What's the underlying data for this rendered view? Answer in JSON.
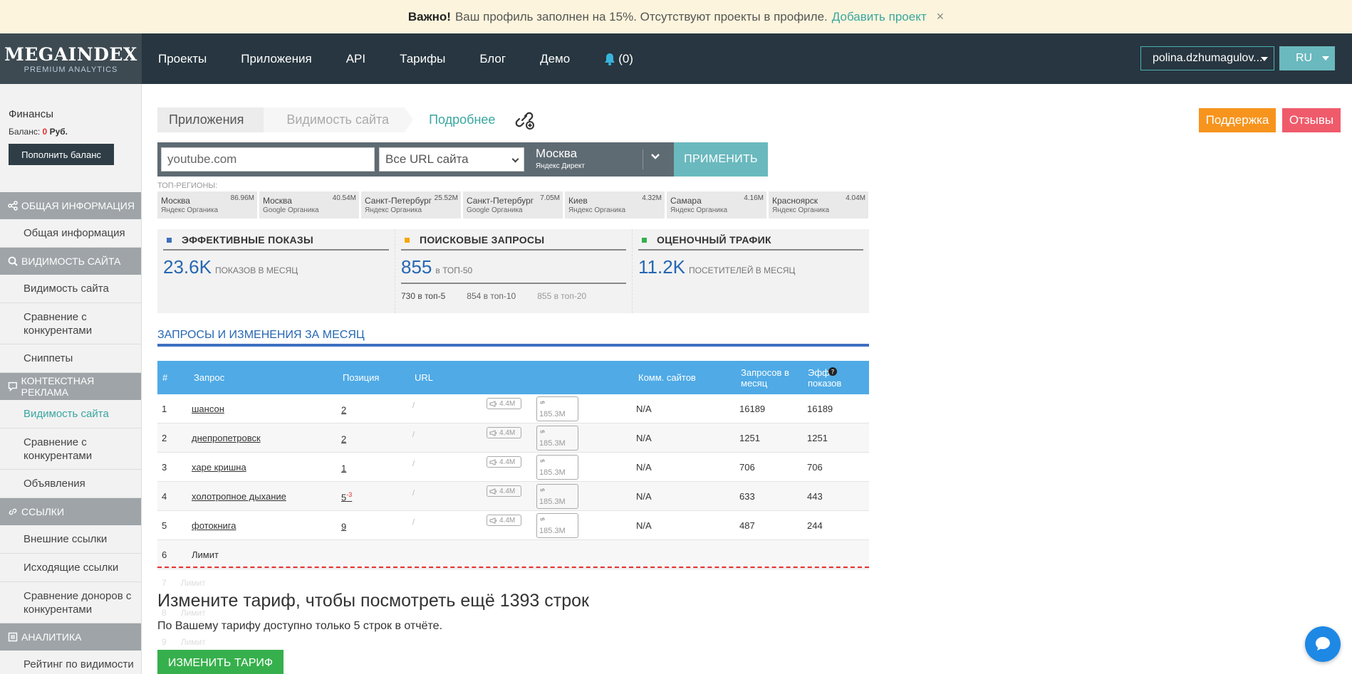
{
  "notice": {
    "strong": "Важно!",
    "text": "Ваш профиль заполнен на 15%. Отсутствуют проекты в профиле.",
    "link": "Добавить проект",
    "close": "×"
  },
  "header": {
    "logo_main": "MEGAINDEX",
    "logo_sub": "PREMIUM ANALYTICS",
    "nav": [
      "Проекты",
      "Приложения",
      "API",
      "Тарифы",
      "Блог",
      "Демо"
    ],
    "notifications": "(0)",
    "user": "polina.dzhumagulov...",
    "lang": "RU"
  },
  "sidebar": {
    "finance_title": "Финансы",
    "balance_label": "Баланс:",
    "balance_value": "0",
    "balance_currency": "Руб.",
    "topup": "Пополнить баланс",
    "sections": [
      {
        "title": "ОБЩАЯ ИНФОРМАЦИЯ",
        "items": [
          "Общая информация"
        ]
      },
      {
        "title": "ВИДИМОСТЬ САЙТА",
        "items": [
          "Видимость сайта",
          "Сравнение с конкурентами",
          "Сниппеты"
        ]
      },
      {
        "title": "КОНТЕКСТНАЯ РЕКЛАМА",
        "items": [
          "Видимость сайта",
          "Сравнение с конкурентами",
          "Объявления"
        ]
      },
      {
        "title": "ССЫЛКИ",
        "items": [
          "Внешние ссылки",
          "Исходящие ссылки",
          "Сравнение доноров с конкурентами"
        ]
      },
      {
        "title": "АНАЛИТИКА",
        "items": [
          "Рейтинг по видимости"
        ]
      }
    ]
  },
  "breadcrumb": [
    "Приложения",
    "Видимость сайта",
    "Подробнее"
  ],
  "support": "Поддержка",
  "reviews": "Отзывы",
  "filters": {
    "domain": "youtube.com",
    "url_select": "Все URL сайта",
    "region": "Москва",
    "region_source": "Яндекс Директ",
    "apply": "ПРИМЕНИТЬ"
  },
  "top_regions_label": "ТОП-РЕГИОНЫ:",
  "regions": [
    {
      "name": "Москва",
      "engine": "Яндекс Органика",
      "value": "86.96M"
    },
    {
      "name": "Москва",
      "engine": "Google Органика",
      "value": "40.54M"
    },
    {
      "name": "Санкт-Петербург",
      "engine": "Яндекс Органика",
      "value": "25.52M"
    },
    {
      "name": "Санкт-Петербург",
      "engine": "Google Органика",
      "value": "7.05M"
    },
    {
      "name": "Киев",
      "engine": "Яндекс Органика",
      "value": "4.32M"
    },
    {
      "name": "Самара",
      "engine": "Яндекс Органика",
      "value": "4.16M"
    },
    {
      "name": "Красноярск",
      "engine": "Яндекс Органика",
      "value": "4.04M"
    }
  ],
  "metrics": [
    {
      "title": "ЭФФЕКТИВНЫЕ ПОКАЗЫ",
      "value": "23.6K",
      "unit": "показов в месяц",
      "color": "#3e6fbf"
    },
    {
      "title": "ПОИСКОВЫЕ ЗАПРОСЫ",
      "value": "855",
      "unit": "в ТОП-50",
      "color": "#f7a600",
      "breakdown": [
        "730 в топ-5",
        "854 в топ-10",
        "855 в топ-20"
      ]
    },
    {
      "title": "ОЦЕНОЧНЫЙ ТРАФИК",
      "value": "11.2K",
      "unit": "посетителей в месяц",
      "color": "#36b04c"
    }
  ],
  "table": {
    "title": "ЗАПРОСЫ И ИЗМЕНЕНИЯ ЗА МЕСЯЦ",
    "headers": [
      "#",
      "Запрос",
      "Позиция",
      "URL",
      "Комм. сайтов",
      "Запросов в месяц",
      "Эфф показов"
    ],
    "rows": [
      {
        "n": "1",
        "q": "шансон",
        "pos": "2",
        "delta": "",
        "ads": "4.4M",
        "links": "185.3M",
        "comm": "N/A",
        "req": "16189",
        "eff": "16189"
      },
      {
        "n": "2",
        "q": "днепропетровск",
        "pos": "2",
        "delta": "",
        "ads": "4.4M",
        "links": "185.3M",
        "comm": "N/A",
        "req": "1251",
        "eff": "1251"
      },
      {
        "n": "3",
        "q": "харе кришна",
        "pos": "1",
        "delta": "",
        "ads": "4.4M",
        "links": "185.3M",
        "comm": "N/A",
        "req": "706",
        "eff": "706"
      },
      {
        "n": "4",
        "q": "холотропное дыхание",
        "pos": "5",
        "delta": "-3",
        "ads": "4.4M",
        "links": "185.3M",
        "comm": "N/A",
        "req": "633",
        "eff": "443"
      },
      {
        "n": "5",
        "q": "фотокнига",
        "pos": "9",
        "delta": "",
        "ads": "4.4M",
        "links": "185.3M",
        "comm": "N/A",
        "req": "487",
        "eff": "244"
      }
    ],
    "limit_row": {
      "n": "6",
      "text": "Лимит"
    },
    "ghost_rows": [
      {
        "n": "7",
        "text": "Лимит"
      },
      {
        "n": "8",
        "text": "Лимит"
      },
      {
        "n": "9",
        "text": "Лимит"
      }
    ]
  },
  "upsell": {
    "title": "Измените тариф, чтобы посмотреть ещё 1393 строк",
    "subtitle": "По Вашему тарифу доступно только 5 строк в отчёте.",
    "button": "ИЗМЕНИТЬ ТАРИФ"
  }
}
